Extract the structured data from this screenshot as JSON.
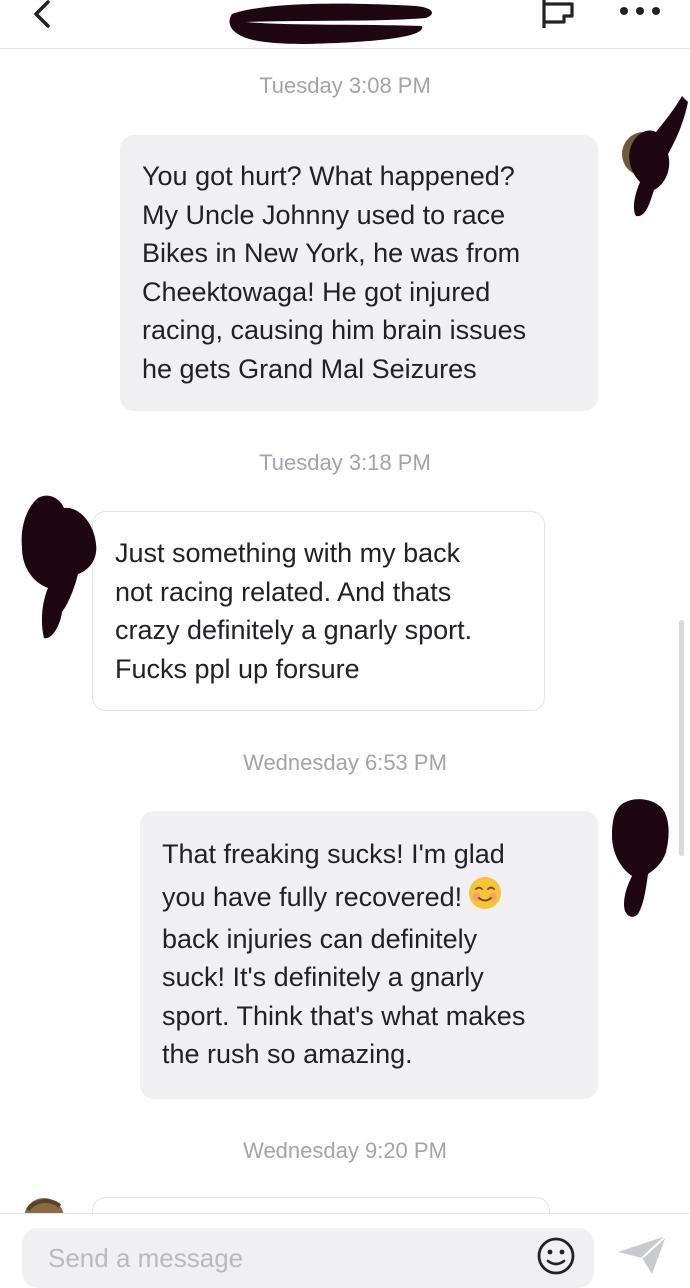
{
  "header": {
    "back_icon": "chevron-left-icon",
    "title_redacted": true,
    "flag_icon": "flag-icon",
    "more_icon": "ellipsis-icon"
  },
  "messages": [
    {
      "timestamp": "Tuesday 3:08 PM",
      "direction": "outgoing",
      "lines": [
        "You got hurt? What happened?",
        "My Uncle Johnny used to race",
        "Bikes in New York, he was from",
        "Cheektowaga! He got injured",
        "racing, causing him brain issues",
        "he gets Grand Mal Seizures"
      ]
    },
    {
      "timestamp": "Tuesday 3:18 PM",
      "direction": "incoming",
      "lines": [
        "Just something with my back",
        "not racing related. And thats",
        "crazy definitely a gnarly sport.",
        "Fucks ppl up forsure"
      ]
    },
    {
      "timestamp": "Wednesday 6:53 PM",
      "direction": "outgoing",
      "lines": [
        "That freaking sucks! I'm glad",
        "you have fully recovered!",
        "back injuries can definitely",
        "suck! It's definitely a gnarly",
        "sport. Think that's what makes",
        "the rush so amazing."
      ],
      "emoji_after_line": 1,
      "emoji": "smiling-blush-emoji"
    },
    {
      "timestamp": "Wednesday 9:20 PM",
      "direction": "incoming",
      "lines": []
    }
  ],
  "composer": {
    "placeholder": "Send a message",
    "emoji_icon": "emoji-icon",
    "send_icon": "send-icon"
  },
  "colors": {
    "outgoing_bubble": "#f0f0f3",
    "incoming_border": "#e5e5e9",
    "timestamp": "#a2a3ab",
    "redaction": "#1e0710"
  }
}
